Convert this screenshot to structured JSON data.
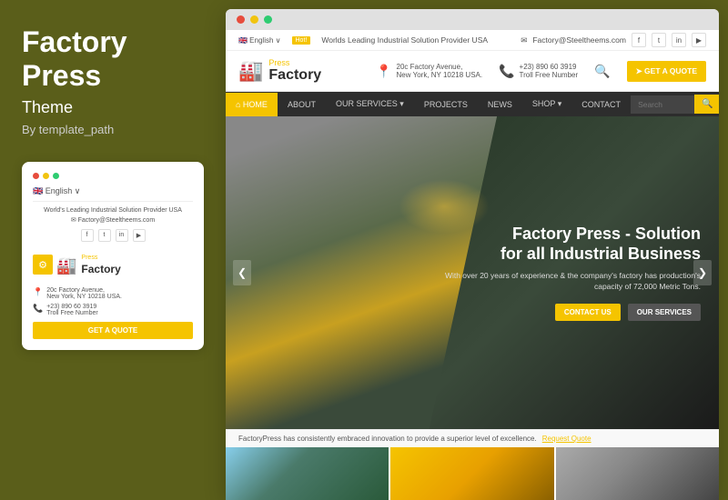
{
  "leftPanel": {
    "title": "Factory\nPress",
    "subtitle": "Theme",
    "by": "By template_path"
  },
  "mobile": {
    "lang": "🇬🇧 English ∨",
    "tagline": "World's Leading Industrial Solution Provider USA",
    "email": "✉ Factory@Steeltheems.com",
    "socials": [
      "f",
      "t",
      "in",
      "▶"
    ],
    "logoText": "Factory",
    "logoPress": "Press",
    "address": "20c Factory Avenue,\nNew York, NY 10218 USA.",
    "phone": "+23) 890 60 3919\nTroll Free Number",
    "ctaLabel": "GET A QUOTE"
  },
  "website": {
    "topbar": {
      "hotText": "Hot!",
      "tagline": "Worlds Leading Industrial Solution Provider USA",
      "email": "Factory@Steeltheems.com",
      "socials": [
        "f",
        "t",
        "in",
        "▶"
      ]
    },
    "header": {
      "logoText": "Factory",
      "logoPress": "Press",
      "address": "20c Factory Avenue,\nNew York, NY 10218 USA.",
      "phone": "+23) 890 60 3919\nTroll Free Number",
      "ctaLabel": "➤ GET A QUOTE"
    },
    "nav": {
      "items": [
        {
          "label": "⌂ HOME",
          "active": true
        },
        {
          "label": "ABOUT",
          "active": false
        },
        {
          "label": "OUR SERVICES ▾",
          "active": false
        },
        {
          "label": "PROJECTS",
          "active": false
        },
        {
          "label": "NEWS",
          "active": false
        },
        {
          "label": "SHOP ▾",
          "active": false
        },
        {
          "label": "CONTACT",
          "active": false
        }
      ],
      "searchPlaceholder": "Search",
      "searchBtnLabel": "🔍"
    },
    "hero": {
      "title": "Factory Press - Solution\nfor all Industrial Business",
      "desc": "With over 20 years of experience & the company's factory has\nproduction's capacity of 72,000 Metric Tons.",
      "btnContact": "CONTACT US",
      "btnServices": "OUR SERVICES",
      "arrowLeft": "❮",
      "arrowRight": "❯"
    },
    "announcement": {
      "text": "FactoryPress has consistently embraced innovation to provide a superior level of excellence.",
      "linkText": "Request Quote"
    }
  }
}
